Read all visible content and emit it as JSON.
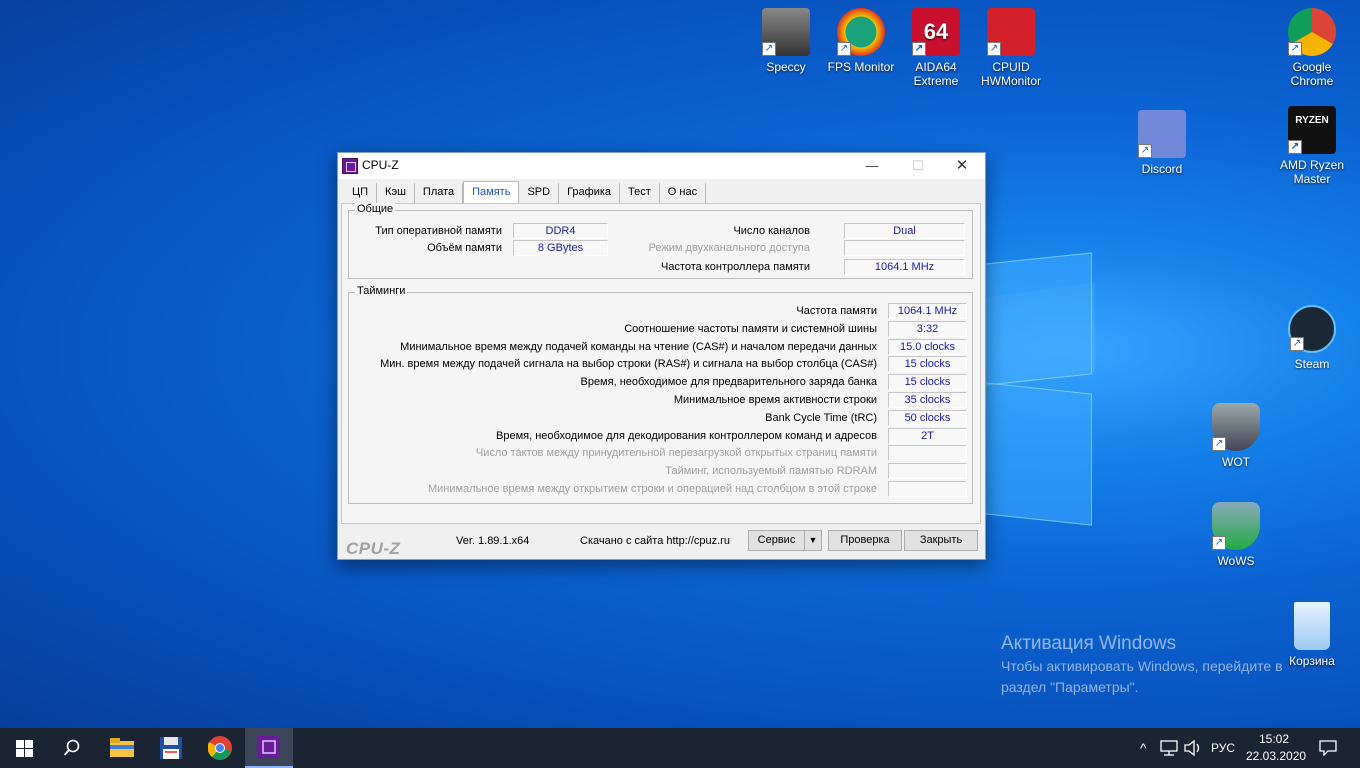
{
  "desktop": {
    "icons": [
      {
        "label": "Speccy"
      },
      {
        "label": "FPS Monitor"
      },
      {
        "label": "AIDA64 Extreme"
      },
      {
        "label": "CPUID HWMonitor"
      },
      {
        "label": "Google Chrome"
      },
      {
        "label": "Discord"
      },
      {
        "label": "AMD Ryzen Master"
      },
      {
        "label": "Steam"
      },
      {
        "label": "WOT"
      },
      {
        "label": "WoWS"
      },
      {
        "label": "Корзина"
      }
    ],
    "activation": {
      "title": "Активация Windows",
      "line1": "Чтобы активировать Windows, перейдите в",
      "line2": "раздел \"Параметры\"."
    }
  },
  "window": {
    "title": "CPU-Z",
    "minimize": "—",
    "maximize": "☐",
    "close": "✕",
    "tabs": [
      "ЦП",
      "Кэш",
      "Плата",
      "Память",
      "SPD",
      "Графика",
      "Тест",
      "О нас"
    ],
    "active_tab": "Память",
    "general": {
      "title": "Общие",
      "type_label": "Тип оперативной памяти",
      "type_value": "DDR4",
      "size_label": "Объём памяти",
      "size_value": "8 GBytes",
      "channels_label": "Число каналов",
      "channels_value": "Dual",
      "dc_mode_label": "Режим двухканального доступа",
      "dc_mode_value": "",
      "nb_freq_label": "Частота контроллера памяти",
      "nb_freq_value": "1064.1 MHz"
    },
    "timings": {
      "title": "Тайминги",
      "rows": [
        {
          "label": "Частота памяти",
          "value": "1064.1 MHz",
          "disabled": false
        },
        {
          "label": "Соотношение частоты памяти и системной шины",
          "value": "3:32",
          "disabled": false
        },
        {
          "label": "Минимальное время между подачей команды на чтение (CAS#) и началом передачи данных",
          "value": "15.0 clocks",
          "disabled": false
        },
        {
          "label": "Мин. время между подачей сигнала на выбор строки (RAS#) и сигнала на выбор столбца (CAS#)",
          "value": "15 clocks",
          "disabled": false
        },
        {
          "label": "Время, необходимое для предварительного заряда банка",
          "value": "15 clocks",
          "disabled": false
        },
        {
          "label": "Минимальное время активности строки",
          "value": "35 clocks",
          "disabled": false
        },
        {
          "label": "Bank Cycle Time (tRC)",
          "value": "50 clocks",
          "disabled": false
        },
        {
          "label": "Время, необходимое для декодирования контроллером команд и адресов",
          "value": "2T",
          "disabled": false
        },
        {
          "label": "Число тактов между принудительной перезагрузкой открытых страниц памяти",
          "value": "",
          "disabled": true
        },
        {
          "label": "Тайминг, используемый памятью RDRAM",
          "value": "",
          "disabled": true
        },
        {
          "label": "Минимальное время между открытием строки и операцией над столбцом в этой строке",
          "value": "",
          "disabled": true
        }
      ]
    },
    "footer": {
      "brand": "CPU-Z",
      "version": "Ver. 1.89.1.x64",
      "download": "Скачано с сайта http://cpuz.ru",
      "service_btn": "Сервис",
      "dropdown_arrow": "▼",
      "check_btn": "Проверка",
      "close_btn": "Закрыть"
    }
  },
  "taskbar": {
    "lang": "РУС",
    "time": "15:02",
    "date": "22.03.2020",
    "caret": "^"
  }
}
